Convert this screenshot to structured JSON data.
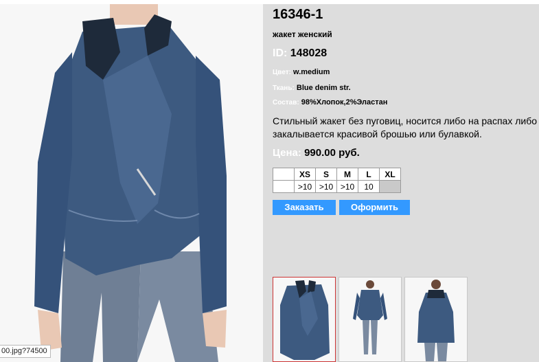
{
  "product": {
    "title": "16346-1",
    "subtitle": "жакет женский",
    "id_label": "ID:",
    "id_value": "148028",
    "color_label": "Цвет:",
    "color_value": "w.medium",
    "fabric_label": "Ткань:",
    "fabric_value": "Blue denim str.",
    "composition_label": "Состав:",
    "composition_value": "98%Хлопок,2%Эластан",
    "description": "Стильный жакет без пуговиц, носится либо на распах либо закалывается красивой брошью или булавкой.",
    "price_label": "Цена:",
    "price_value": "990.00 руб."
  },
  "sizes": {
    "headers": [
      "XS",
      "S",
      "M",
      "L",
      "XL"
    ],
    "stock": [
      ">10",
      ">10",
      ">10",
      "10",
      ""
    ]
  },
  "buttons": {
    "order": "Заказать",
    "checkout": "Оформить"
  },
  "status_tip": "00.jpg?74500",
  "colors": {
    "panel_bg": "#dddddd",
    "button_bg": "#3399ff",
    "active_thumb_border": "#cc3333"
  }
}
